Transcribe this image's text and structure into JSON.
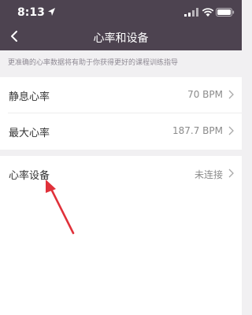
{
  "status": {
    "time": "8:13"
  },
  "nav": {
    "title": "心率和设备"
  },
  "hint": "更准确的心率数据将有助于你获得更好的课程训练指导",
  "rows": [
    {
      "label": "静息心率",
      "value": "70 BPM"
    },
    {
      "label": "最大心率",
      "value": "187.7 BPM"
    },
    {
      "label": "心率设备",
      "value": "未连接"
    }
  ],
  "colors": {
    "header": "#4d4350",
    "background": "#f1f0f2",
    "annotation_arrow": "#e0313a"
  }
}
